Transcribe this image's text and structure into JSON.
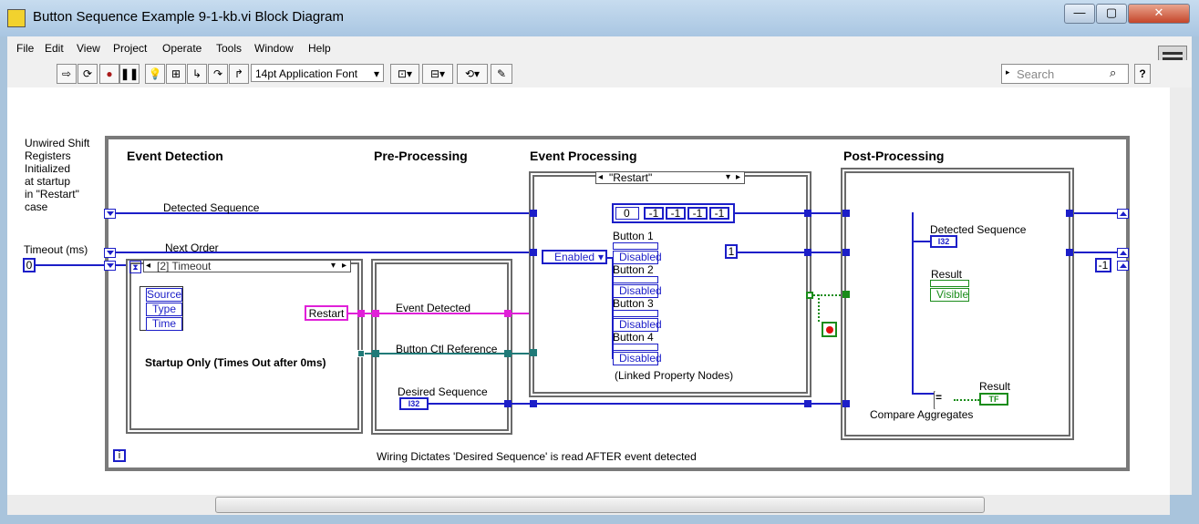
{
  "window": {
    "title": "Button Sequence Example 9-1-kb.vi Block Diagram",
    "controls": [
      "—",
      "▢",
      "✕"
    ]
  },
  "menu": [
    "File",
    "Edit",
    "View",
    "Project",
    "Operate",
    "Tools",
    "Window",
    "Help"
  ],
  "toolbar": {
    "font": "14pt Application Font",
    "search_placeholder": "Search",
    "help": "?"
  },
  "diagram": {
    "note_lines": [
      "Unwired Shift",
      "Registers",
      "Initialized",
      "at startup",
      "in \"Restart\"",
      "case"
    ],
    "timeout_label": "Timeout (ms)",
    "timeout_value": "0",
    "headers": {
      "event_detection": "Event Detection",
      "pre_processing": "Pre-Processing",
      "event_processing": "Event Processing",
      "post_processing": "Post-Processing"
    },
    "wire_labels": {
      "detected_sequence": "Detected Sequence",
      "next_order": "Next Order",
      "event_detected": "Event Detected",
      "button_ctl_reference": "Button Ctl Reference",
      "desired_sequence": "Desired Sequence"
    },
    "event_case": {
      "selector": "[2] Timeout",
      "data_items": [
        "Source",
        "Type",
        "Time"
      ],
      "note": "Startup Only (Times Out after 0ms)",
      "restart": "Restart"
    },
    "case_selector": "\"Restart\"",
    "array": {
      "index": "0",
      "values": [
        "-1",
        "-1",
        "-1",
        "-1"
      ]
    },
    "enabled": "Enabled",
    "constant_one": "1",
    "buttons": [
      {
        "name": "Button 1",
        "prop": "Disabled"
      },
      {
        "name": "Button 2",
        "prop": "Disabled"
      },
      {
        "name": "Button 3",
        "prop": "Disabled"
      },
      {
        "name": "Button 4",
        "prop": "Disabled"
      }
    ],
    "linked_note": "(Linked Property Nodes)",
    "desired_term": "I32",
    "post": {
      "detected_sequence": "Detected Sequence",
      "i32": "I32",
      "result_label": "Result",
      "visible": "Visible",
      "result2": "Result",
      "tf": "TF",
      "compare": "Compare Aggregates",
      "eq": "="
    },
    "minus_one": "-1",
    "info": "i",
    "footer": "Wiring Dictates 'Desired Sequence' is read AFTER event detected"
  },
  "colors": {
    "wire_int": "#1c1ec8",
    "wire_cluster": "#e020d8",
    "wire_ref": "#207a78",
    "wire_bool": "#1a8c1a",
    "frame": "#7a7a7a"
  }
}
